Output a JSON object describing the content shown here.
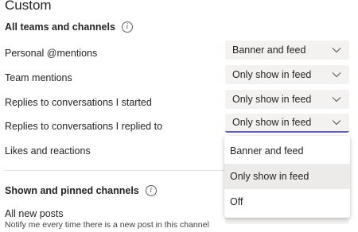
{
  "heading": "Custom",
  "sections": {
    "all_teams": {
      "title": "All teams and channels",
      "info_icon": "info-icon"
    },
    "shown_pinned": {
      "title": "Shown and pinned channels",
      "info_icon": "info-icon"
    }
  },
  "rows": [
    {
      "label": "Personal @mentions",
      "value": "Banner and feed"
    },
    {
      "label": "Team mentions",
      "value": "Only show in feed"
    },
    {
      "label": "Replies to conversations I started",
      "value": "Only show in feed"
    },
    {
      "label": "Replies to conversations I replied to",
      "value": "Only show in feed"
    },
    {
      "label": "Likes and reactions"
    }
  ],
  "all_new_posts": {
    "label": "All new posts",
    "description": "Notify me every time there is a new post in this channel"
  },
  "dropdown_menu": {
    "options": [
      "Banner and feed",
      "Only show in feed",
      "Off"
    ],
    "selected": "Only show in feed"
  },
  "colors": {
    "accent": "#6264a7",
    "dropdown_bg": "#f3f2f1",
    "selected_bg": "#edebe9"
  },
  "icons": {
    "dropdown": "chevron-down-icon",
    "info": "info-icon"
  }
}
